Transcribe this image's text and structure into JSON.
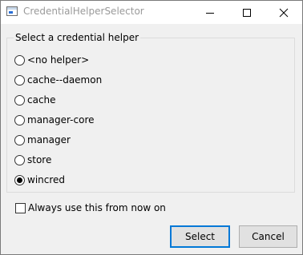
{
  "window": {
    "title": "CredentialHelperSelector"
  },
  "group": {
    "label": "Select a credential helper",
    "options": [
      {
        "label": "<no helper>",
        "checked": false
      },
      {
        "label": "cache--daemon",
        "checked": false
      },
      {
        "label": "cache",
        "checked": false
      },
      {
        "label": "manager-core",
        "checked": false
      },
      {
        "label": "manager",
        "checked": false
      },
      {
        "label": "store",
        "checked": false
      },
      {
        "label": "wincred",
        "checked": true
      }
    ]
  },
  "always_use": {
    "label": "Always use this from now on",
    "checked": false
  },
  "buttons": {
    "select": "Select",
    "cancel": "Cancel"
  },
  "colors": {
    "accent": "#0078d7",
    "dialog_bg": "#f0f0f0"
  },
  "icons": {
    "app": "window-app-icon",
    "minimize": "minimize-icon",
    "maximize": "maximize-icon",
    "close": "close-icon"
  }
}
